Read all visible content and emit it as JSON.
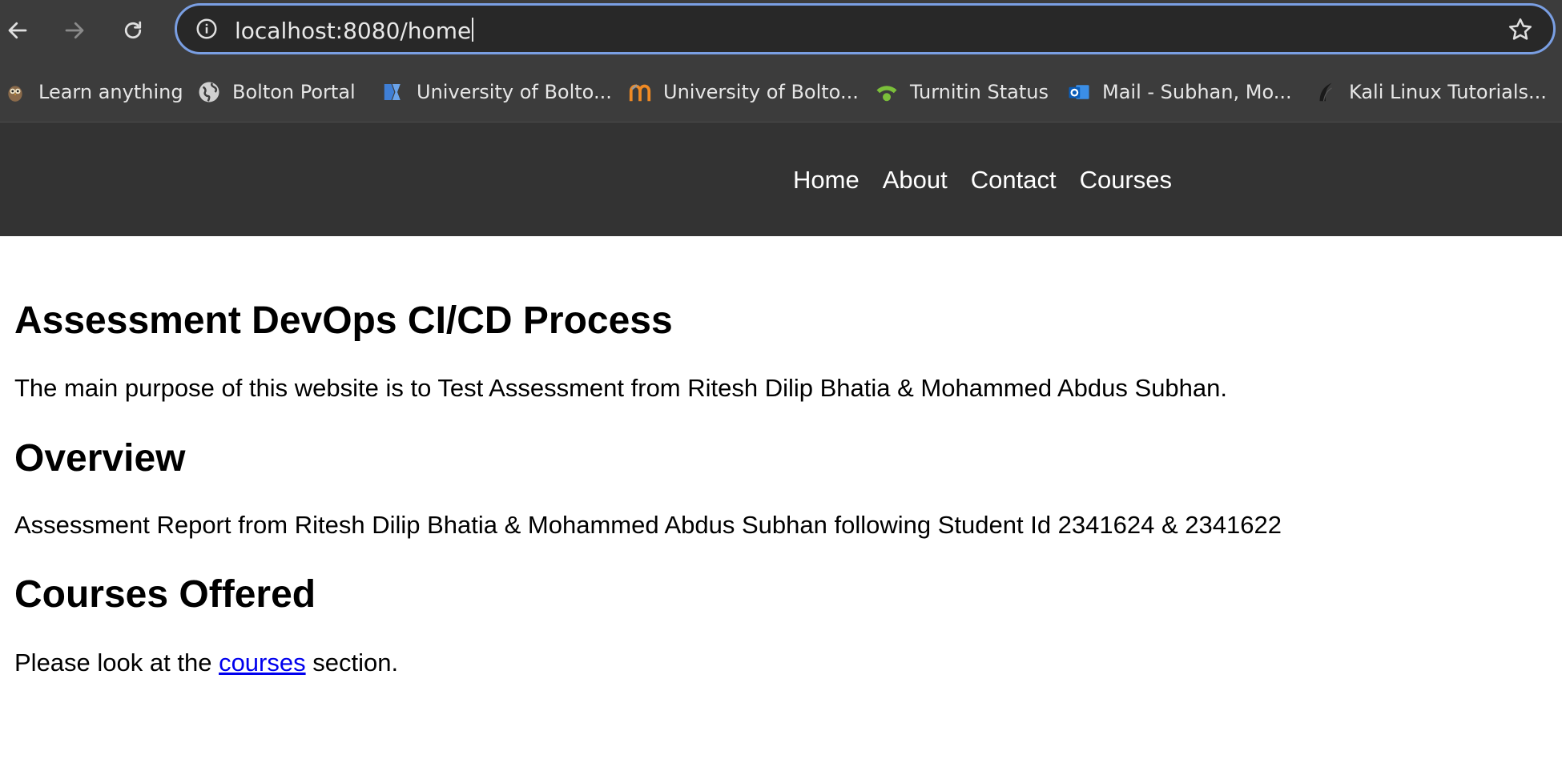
{
  "browser": {
    "url": "localhost:8080/home",
    "bookmarks": [
      {
        "label": "Learn anything",
        "icon": "owl-icon"
      },
      {
        "label": "Bolton Portal",
        "icon": "globe-icon"
      },
      {
        "label": "University of Bolto...",
        "icon": "university-logo-icon"
      },
      {
        "label": "University of Bolto...",
        "icon": "moodle-icon"
      },
      {
        "label": "Turnitin Status",
        "icon": "signal-icon"
      },
      {
        "label": "Mail - Subhan, Mo...",
        "icon": "outlook-icon"
      },
      {
        "label": "Kali Linux Tutorials...",
        "icon": "kali-icon"
      }
    ]
  },
  "site": {
    "nav": [
      "Home",
      "About",
      "Contact",
      "Courses"
    ]
  },
  "main": {
    "title": "Assessment DevOps CI/CD Process",
    "intro": "The main purpose of this website is to Test Assessment from Ritesh Dilip Bhatia & Mohammed Abdus Subhan.",
    "overview_heading": "Overview",
    "overview_text": "Assessment Report from Ritesh Dilip Bhatia & Mohammed Abdus Subhan following Student Id 2341624 & 2341622",
    "courses_heading": "Courses Offered",
    "courses_text_before": "Please look at the ",
    "courses_link": "courses",
    "courses_text_after": " section."
  }
}
